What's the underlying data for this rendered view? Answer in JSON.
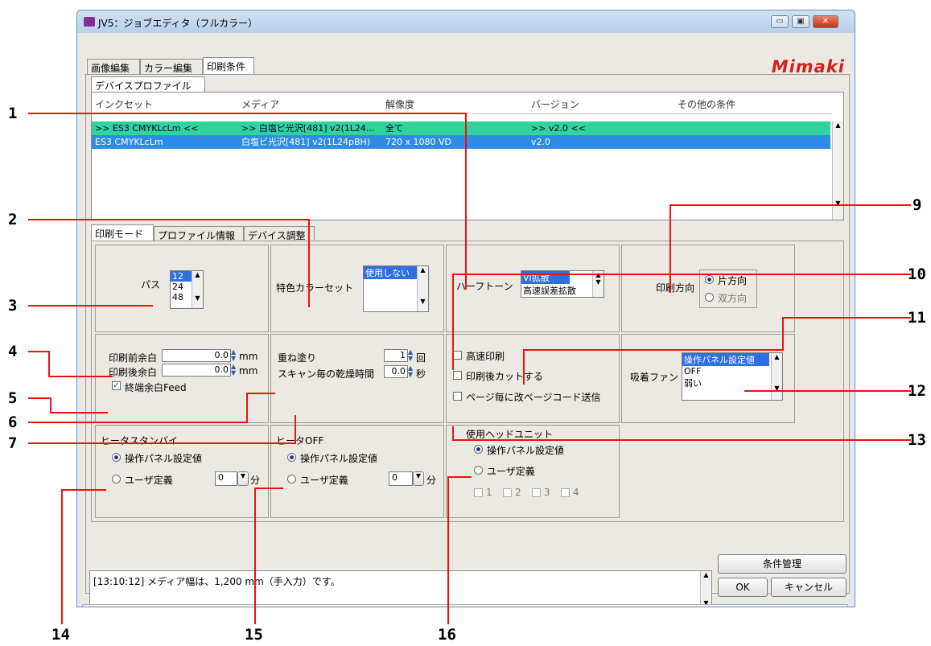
{
  "window": {
    "title": "JV5：ジョブエディタ（フルカラー）",
    "logo": "Mimaki",
    "controls": {
      "minimize": "▭",
      "maximize": "▣",
      "close": "✕"
    }
  },
  "top_tabs": [
    "画像編集",
    "カラー編集",
    "印刷条件"
  ],
  "device_profile": {
    "tab": "デバイスプロファイル",
    "columns": [
      "インクセット",
      "メディア",
      "解像度",
      "バージョン",
      "その他の条件"
    ],
    "rows": [
      [
        ">> ES3 CMYKLcLm <<",
        ">> 白塩ビ光沢[481] v2(1L24...",
        "全て",
        ">> v2.0 <<",
        ""
      ],
      [
        "ES3 CMYKLcLm",
        "白塩ビ光沢[481] v2(1L24pBH)",
        "720 x 1080 VD",
        "v2.0",
        ""
      ]
    ]
  },
  "sub_tabs": [
    "印刷モード",
    "プロファイル情報",
    "デバイス調整"
  ],
  "print_mode": {
    "pass": {
      "label": "パス",
      "options": [
        "12",
        "24",
        "48"
      ]
    },
    "spot_color": {
      "label": "特色カラーセット",
      "options": [
        "使用しない"
      ]
    },
    "halftone": {
      "label": "ハーフトーン",
      "options": [
        "VI拡散",
        "高速誤差拡散"
      ]
    },
    "direction": {
      "label": "印刷方向",
      "options": [
        "片方向",
        "双方向"
      ]
    },
    "margins": {
      "front_label": "印刷前余白",
      "front_value": "0.0",
      "unit": "mm",
      "back_label": "印刷後余白",
      "back_value": "0.0",
      "back_unit": "mm",
      "feed_label": "終端余白Feed"
    },
    "overprint": {
      "label": "重ね塗り",
      "value": "1",
      "unit": "回"
    },
    "dry_time": {
      "label": "スキャン毎の乾燥時間",
      "value": "0.0",
      "unit": "秒"
    },
    "high_speed": "高速印刷",
    "cut_after": "印刷後カットする",
    "page_code": "ページ毎に改ページコード送信",
    "fan": {
      "label": "吸着ファン",
      "options": [
        "操作パネル設定値",
        "OFF",
        "弱い"
      ]
    },
    "heater_standby": {
      "title": "ヒータスタンバイ",
      "opt1": "操作パネル設定値",
      "opt2": "ユーザ定義",
      "value": "0",
      "unit": "分"
    },
    "heater_off": {
      "title": "ヒータOFF",
      "opt1": "操作パネル設定値",
      "opt2": "ユーザ定義",
      "value": "0",
      "unit": "分"
    },
    "head_unit": {
      "title": "使用ヘッドユニット",
      "opt1": "操作パネル設定値",
      "opt2": "ユーザ定義",
      "heads": [
        "1",
        "2",
        "3",
        "4"
      ]
    }
  },
  "status": {
    "message": "[13:10:12] メディア幅は、1,200 mm（手入力）です。",
    "condition_button": "条件管理",
    "ok_button": "OK",
    "cancel_button": "キャンセル"
  },
  "callouts": [
    "1",
    "2",
    "3",
    "4",
    "5",
    "6",
    "7",
    "9",
    "10",
    "11",
    "12",
    "13",
    "14",
    "15",
    "16"
  ],
  "colors": {
    "row_highlight_green": "#2fd39b",
    "row_highlight_blue": "#2f8ce6",
    "callout_line": "#e11111",
    "logo": "#d3201b"
  }
}
